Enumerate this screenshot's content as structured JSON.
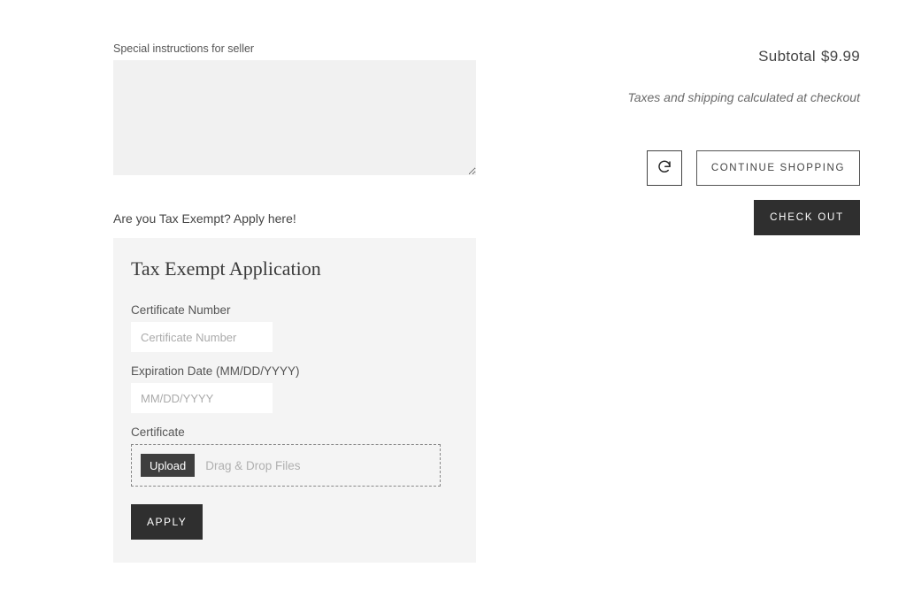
{
  "instructions": {
    "label": "Special instructions for seller",
    "value": ""
  },
  "tax_exempt": {
    "question": "Are you Tax Exempt? Apply here!",
    "title": "Tax Exempt Application",
    "cert_number_label": "Certificate Number",
    "cert_number_placeholder": "Certificate Number",
    "expiration_label": "Expiration Date (MM/DD/YYYY)",
    "expiration_placeholder": "MM/DD/YYYY",
    "certificate_label": "Certificate",
    "upload_label": "Upload",
    "drop_text": "Drag & Drop Files",
    "apply_label": "APPLY"
  },
  "summary": {
    "subtotal_label": "Subtotal",
    "subtotal_value": "$9.99",
    "taxes_note": "Taxes and shipping calculated at checkout",
    "continue_label": "CONTINUE SHOPPING",
    "checkout_label": "CHECK OUT"
  }
}
